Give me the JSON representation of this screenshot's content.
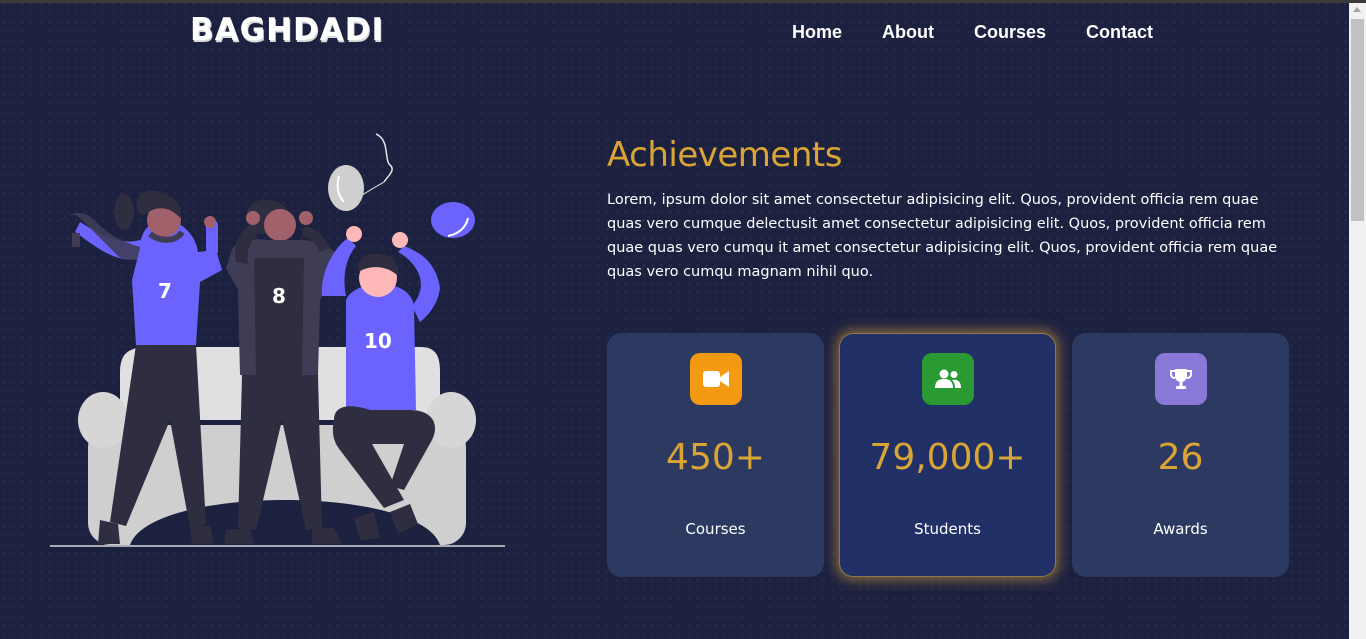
{
  "brand": {
    "logo_text": "BAGHDADI"
  },
  "nav": {
    "items": [
      "Home",
      "About",
      "Courses",
      "Contact"
    ]
  },
  "illustration": {
    "jersey_numbers": [
      "7",
      "8",
      "10"
    ]
  },
  "achievements": {
    "title": "Achievements",
    "description": "Lorem, ipsum dolor sit amet consectetur adipisicing elit. Quos, provident officia rem quae quas vero cumque delectusit amet consectetur adipisicing elit. Quos, provident officia rem quae quas vero cumqu it amet consectetur adipisicing elit. Quos, provident officia rem quae quas vero cumqu magnam nihil quo."
  },
  "stats": [
    {
      "value": "450+",
      "label": "Courses",
      "icon": "video-camera-icon",
      "color": "#f39a12"
    },
    {
      "value": "79,000+",
      "label": "Students",
      "icon": "users-icon",
      "color": "#2a9a33"
    },
    {
      "value": "26",
      "label": "Awards",
      "icon": "trophy-icon",
      "color": "#8a78d8"
    }
  ],
  "colors": {
    "background": "#1d2140",
    "accent": "#dba535",
    "card": "#2c3a62",
    "card_active": "#223068"
  }
}
